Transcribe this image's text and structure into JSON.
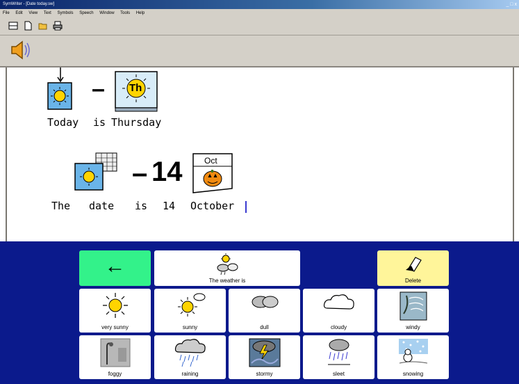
{
  "window": {
    "title": "SymWriter - [Date today.sw]",
    "controls": "_ □ x"
  },
  "menu": [
    "File",
    "Edit",
    "View",
    "Text",
    "Symbols",
    "Speech",
    "Window",
    "Tools",
    "Help"
  ],
  "toolbar_icons": [
    "layout-icon",
    "new-document-icon",
    "open-folder-icon",
    "print-icon"
  ],
  "document": {
    "line1": {
      "today": "Today",
      "is": "is",
      "thursday": "Thursday",
      "th_badge": "Th"
    },
    "line2": {
      "the": "The",
      "date": "date",
      "is": "is",
      "number": "14",
      "month": "October",
      "calendar_month": "Oct",
      "big_number": "14"
    },
    "dash": "–"
  },
  "grid": {
    "back_label": "←",
    "header_label": "The weather is",
    "delete_label": "Delete",
    "row1": [
      {
        "label": "very sunny",
        "icon": "very-sunny-icon"
      },
      {
        "label": "sunny",
        "icon": "sunny-icon"
      },
      {
        "label": "dull",
        "icon": "dull-icon"
      },
      {
        "label": "cloudy",
        "icon": "cloudy-icon"
      },
      {
        "label": "windy",
        "icon": "windy-icon"
      }
    ],
    "row2": [
      {
        "label": "foggy",
        "icon": "foggy-icon"
      },
      {
        "label": "raining",
        "icon": "raining-icon"
      },
      {
        "label": "stormy",
        "icon": "stormy-icon"
      },
      {
        "label": "sleet",
        "icon": "sleet-icon"
      },
      {
        "label": "snowing",
        "icon": "snowing-icon"
      }
    ]
  },
  "colors": {
    "grid_background": "#0b1a8c",
    "back_button": "#33f28a",
    "delete_button": "#fff59a",
    "sun_yellow": "#ffd400",
    "symbol_frame": "#6ab4e8"
  }
}
